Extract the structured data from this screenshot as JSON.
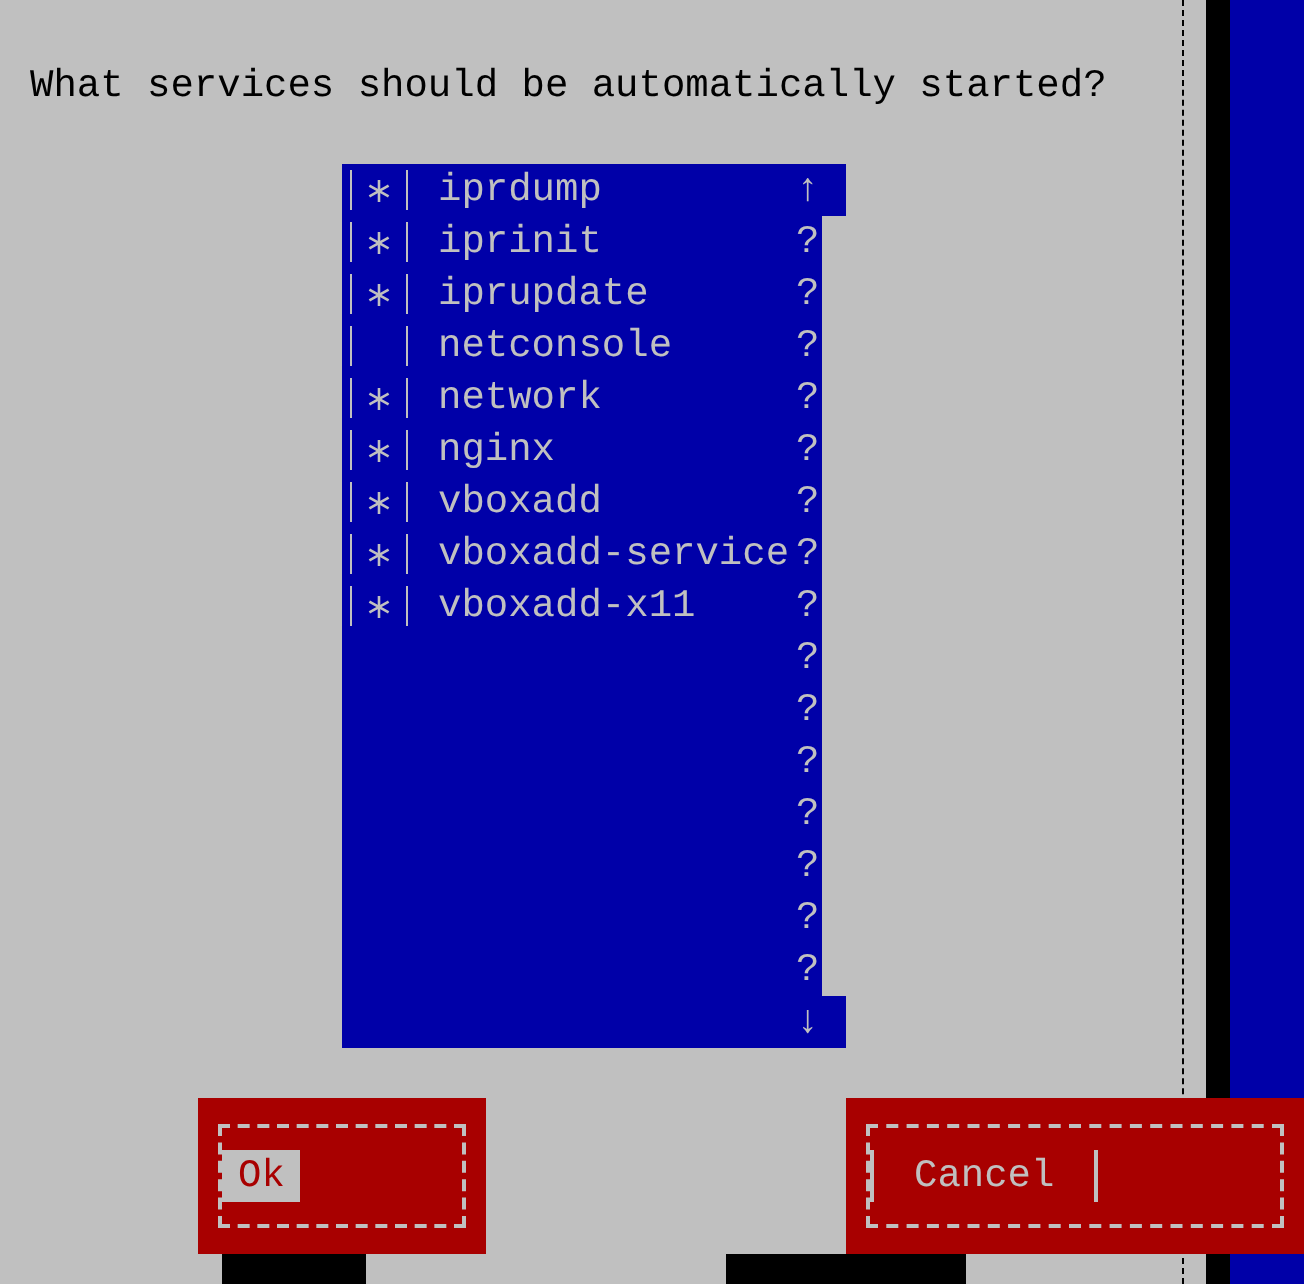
{
  "prompt": "What services should be automatically started?",
  "services": [
    {
      "name": "iprdump",
      "checked": true
    },
    {
      "name": "iprinit",
      "checked": true
    },
    {
      "name": "iprupdate",
      "checked": true
    },
    {
      "name": "netconsole",
      "checked": false
    },
    {
      "name": "network",
      "checked": true
    },
    {
      "name": "nginx",
      "checked": true
    },
    {
      "name": "vboxadd",
      "checked": true
    },
    {
      "name": "vboxadd-service",
      "checked": true
    },
    {
      "name": "vboxadd-x11",
      "checked": true
    }
  ],
  "scrollbar": {
    "up": "↑",
    "marks": [
      "?",
      "?",
      "?",
      "?",
      "?",
      "?",
      "?",
      "?",
      "?",
      "?",
      "?",
      "?",
      "?",
      "?",
      "?"
    ],
    "down": "↓"
  },
  "buttons": [
    {
      "label": "Ok",
      "focused": true
    },
    {
      "label": "Cancel",
      "focused": false
    }
  ]
}
